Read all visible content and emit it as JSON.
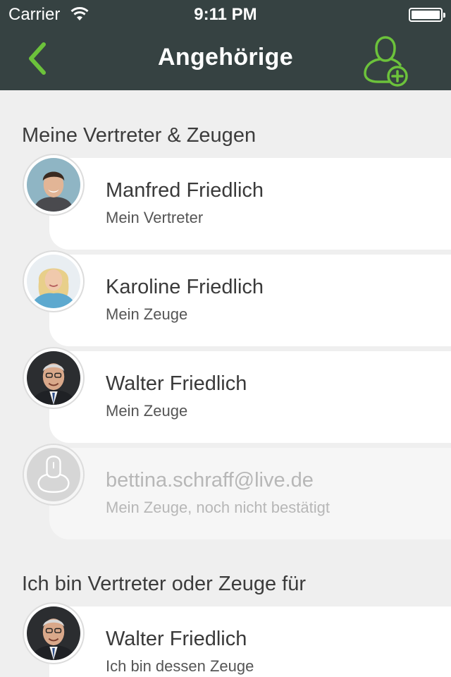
{
  "status_bar": {
    "carrier": "Carrier",
    "time": "9:11 PM"
  },
  "nav": {
    "title": "Angehörige",
    "back_icon": "chevron-left-icon",
    "add_icon": "add-person-icon"
  },
  "colors": {
    "accent": "#6cc23b",
    "bar": "#364242"
  },
  "sections": [
    {
      "title": "Meine Vertreter & Zeugen"
    },
    {
      "title": "Ich bin Vertreter oder Zeuge für"
    }
  ],
  "contacts": [
    {
      "name": "Manfred Friedlich",
      "role": "Mein Vertreter"
    },
    {
      "name": "Karoline Friedlich",
      "role": "Mein Zeuge"
    },
    {
      "name": "Walter Friedlich",
      "role": "Mein Zeuge"
    },
    {
      "name": "bettina.schraff@live.de",
      "role": "Mein Zeuge, noch nicht bestätigt"
    }
  ],
  "represented": [
    {
      "name": "Walter Friedlich",
      "role": "Ich bin dessen Zeuge"
    }
  ]
}
